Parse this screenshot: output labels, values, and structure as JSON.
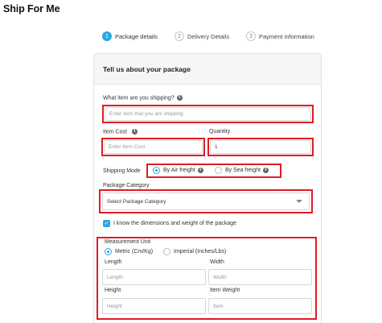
{
  "page": {
    "title": "Ship For Me"
  },
  "steps": [
    {
      "num": "1",
      "label": "Package details"
    },
    {
      "num": "2",
      "label": "Delivery Details"
    },
    {
      "num": "3",
      "label": "Payment information"
    }
  ],
  "card": {
    "title": "Tell us about your package"
  },
  "item": {
    "label": "What item are you shipping?",
    "placeholder": "Enter item that you are shipping"
  },
  "cost": {
    "label": "Item Cost",
    "placeholder": "Enter Item Cost"
  },
  "quantity": {
    "label": "Quantity",
    "value": "1"
  },
  "shipping_mode": {
    "label": "Shipping Mode",
    "air": "By Air freight",
    "sea": "By Sea freight",
    "selected": "air"
  },
  "category": {
    "label": "Package Category",
    "value": "Select Package Category"
  },
  "dimensions_check": {
    "label": "I know the dimensions and weight of the package",
    "checked": true
  },
  "measurement": {
    "label": "Measurement Unit",
    "metric": "Metric (Cm/Kg)",
    "imperial": "Imperial (Inches/Lbs)",
    "selected": "metric",
    "length": {
      "label": "Length",
      "placeholder": "Length"
    },
    "width": {
      "label": "Width",
      "placeholder": "Width"
    },
    "height": {
      "label": "Height",
      "placeholder": "Height"
    },
    "weight": {
      "label": "Item Weight",
      "placeholder": "Item"
    }
  },
  "icons": {
    "info": "info-icon",
    "check": "checkmark-icon",
    "caret": "chevron-down-icon"
  },
  "colors": {
    "accent": "#29a8e0",
    "highlight": "#e01b24"
  }
}
